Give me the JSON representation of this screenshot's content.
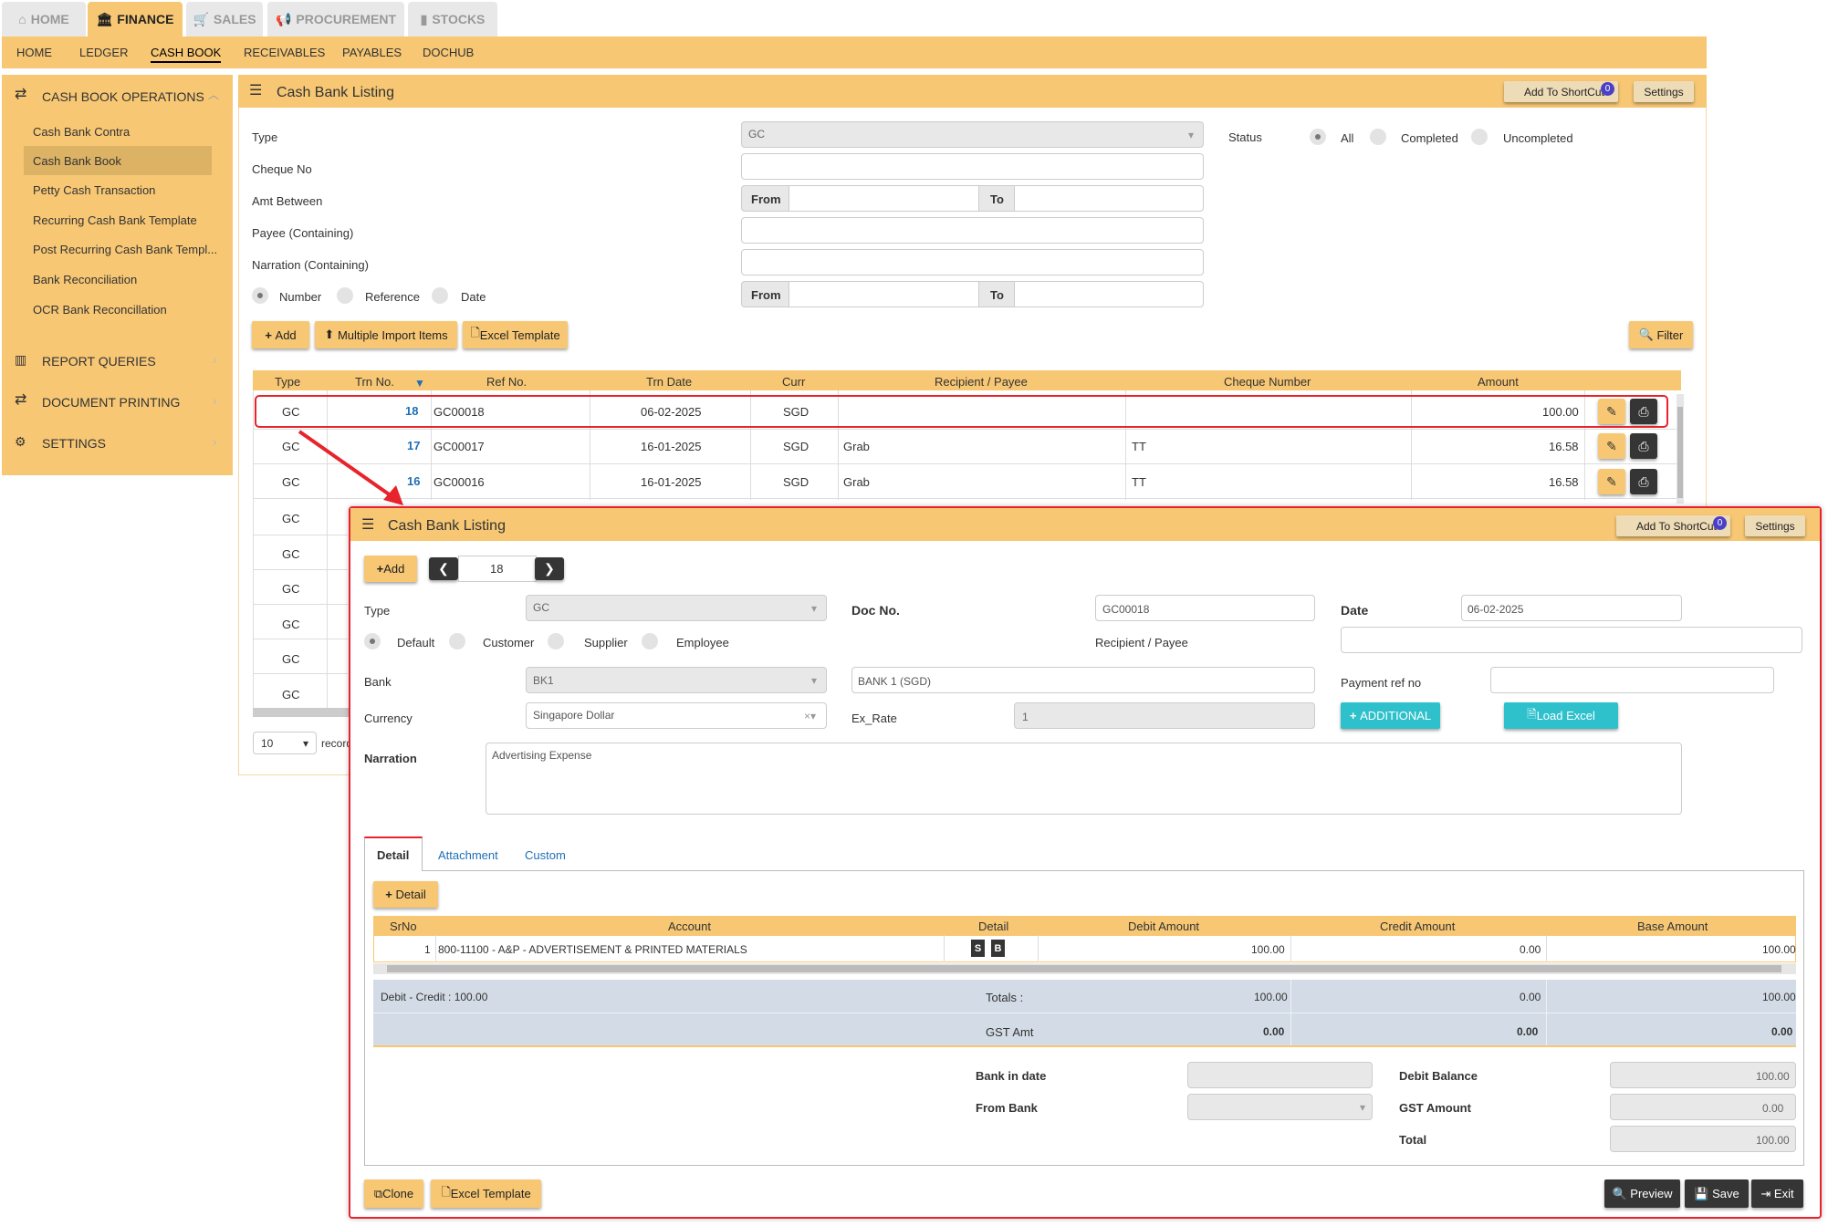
{
  "topnav": {
    "tabs": [
      {
        "label": "HOME",
        "icon": "home-icon"
      },
      {
        "label": "FINANCE",
        "icon": "bank-icon"
      },
      {
        "label": "SALES",
        "icon": "cart-icon"
      },
      {
        "label": "PROCUREMENT",
        "icon": "bullhorn-icon"
      },
      {
        "label": "STOCKS",
        "icon": "bar-chart-icon"
      }
    ]
  },
  "subnav": [
    "HOME",
    "LEDGER",
    "CASH BOOK",
    "RECEIVABLES",
    "PAYABLES",
    "DOCHUB"
  ],
  "sidebar": {
    "group1": "CASH BOOK OPERATIONS",
    "items": [
      "Cash Bank Contra",
      "Cash Bank Book",
      "Petty Cash Transaction",
      "Recurring Cash Bank Template",
      "Post Recurring Cash Bank Templ...",
      "Bank Reconciliation",
      "OCR Bank Reconcillation"
    ],
    "groups": [
      "REPORT QUERIES",
      "DOCUMENT PRINTING",
      "SETTINGS"
    ]
  },
  "listing": {
    "title": "Cash Bank Listing",
    "shortcut": "Add To ShortCut",
    "shortcut_count": "0",
    "settings": "Settings",
    "filters": {
      "type_label": "Type",
      "type_value": "GC",
      "cheque_label": "Cheque No",
      "amt_label": "Amt Between",
      "from": "From",
      "to": "To",
      "payee_label": "Payee (Containing)",
      "narration_label": "Narration (Containing)",
      "sort_options": [
        "Number",
        "Reference",
        "Date"
      ],
      "status_label": "Status",
      "status_options": [
        "All",
        "Completed",
        "Uncompleted"
      ]
    },
    "buttons": {
      "add": "Add",
      "multi": "Multiple Import Items",
      "excel": "Excel Template",
      "filter": "Filter"
    },
    "columns": [
      "Type",
      "Trn No.",
      "Ref No.",
      "Trn Date",
      "Curr",
      "Recipient / Payee",
      "Cheque Number",
      "Amount"
    ],
    "rows": [
      {
        "type": "GC",
        "trn": "18",
        "ref": "GC00018",
        "date": "06-02-2025",
        "curr": "SGD",
        "payee": "",
        "cheque": "",
        "amount": "100.00"
      },
      {
        "type": "GC",
        "trn": "17",
        "ref": "GC00017",
        "date": "16-01-2025",
        "curr": "SGD",
        "payee": "Grab",
        "cheque": "TT",
        "amount": "16.58"
      },
      {
        "type": "GC",
        "trn": "16",
        "ref": "GC00016",
        "date": "16-01-2025",
        "curr": "SGD",
        "payee": "Grab",
        "cheque": "TT",
        "amount": "16.58"
      }
    ],
    "hidden_types": [
      "GC",
      "GC",
      "GC",
      "GC",
      "GC",
      "GC"
    ],
    "page_size": "10",
    "records_label": "record"
  },
  "detail": {
    "title": "Cash Bank Listing",
    "shortcut": "Add To ShortCut",
    "shortcut_count": "0",
    "settings": "Settings",
    "add": "Add",
    "trn_no": "18",
    "type_label": "Type",
    "type_value": "GC",
    "doc_label": "Doc No.",
    "doc_value": "GC00018",
    "date_label": "Date",
    "date_value": "06-02-2025",
    "payee_types": [
      "Default",
      "Customer",
      "Supplier",
      "Employee"
    ],
    "recipient_label": "Recipient / Payee",
    "bank_label": "Bank",
    "bank_value": "BK1",
    "bank_name": "BANK 1 (SGD)",
    "payref_label": "Payment ref no",
    "currency_label": "Currency",
    "currency_value": "Singapore Dollar",
    "exrate_label": "Ex_Rate",
    "exrate_value": "1",
    "additional": "ADDITIONAL",
    "load_excel": "Load Excel",
    "narration_label": "Narration",
    "narration_value": "Advertising Expense",
    "tabs": [
      "Detail",
      "Attachment",
      "Custom"
    ],
    "detail_btn": "Detail",
    "columns": [
      "SrNo",
      "Account",
      "Detail",
      "Debit Amount",
      "Credit Amount",
      "Base Amount"
    ],
    "row": {
      "srno": "1",
      "account": "800-11100 - A&P - ADVERTISEMENT & PRINTED MATERIALS",
      "s": "S",
      "b": "B",
      "debit": "100.00",
      "credit": "0.00",
      "base": "100.00"
    },
    "diff": "Debit - Credit : 100.00",
    "totals_label": "Totals :",
    "totals": [
      "100.00",
      "0.00",
      "100.00"
    ],
    "gst_label": "GST Amt",
    "gst": [
      "0.00",
      "0.00",
      "0.00"
    ],
    "bankin_label": "Bank in date",
    "frombank_label": "From Bank",
    "debit_bal_label": "Debit Balance",
    "debit_bal": "100.00",
    "gst_amount_label": "GST Amount",
    "gst_amount": "0.00",
    "total_label": "Total",
    "total": "100.00",
    "clone": "Clone",
    "excel": "Excel Template",
    "preview": "Preview",
    "save": "Save",
    "exit": "Exit"
  },
  "colors": {
    "accent": "#f7c774",
    "highlight": "#e8232b",
    "link": "#1f6fb5",
    "cyan": "#2ec1cc"
  }
}
